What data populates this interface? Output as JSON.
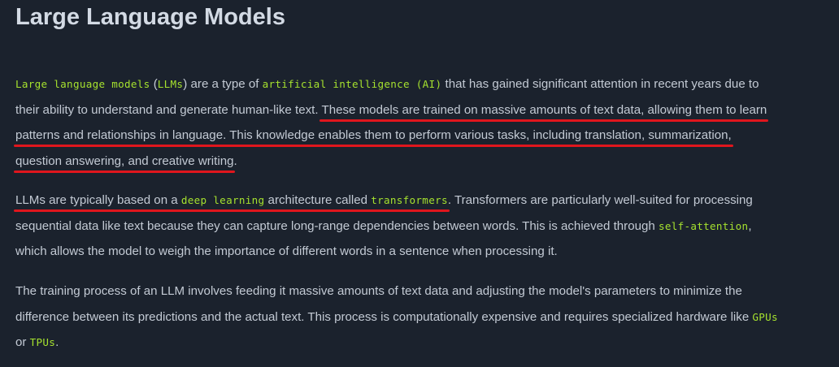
{
  "title": "Large Language Models",
  "colors": {
    "background": "#1b222d",
    "text": "#c3cad4",
    "heading": "#d3dae4",
    "code_term": "#a6e22e",
    "annotation_underline": "#e0161d"
  },
  "p1": {
    "l1_code1": "Large language models",
    "l1_t1": " (",
    "l1_code2": "LLMs",
    "l1_t2": ") are a type of ",
    "l1_code3": "artificial intelligence (AI)",
    "l1_t3": " that has gained significant attention in recent years due to",
    "l2_t1": "their ability to understand and generate human-like text. ",
    "l2_hl": "These models are trained on massive amounts of text data, allowing them to learn",
    "l3_hl": "patterns and relationships in language. This knowledge enables them to perform various tasks, including translation, summarization,",
    "l4_hl": "question answering, and creative writing",
    "l4_t1": "."
  },
  "p2": {
    "l1_hl_t1": "LLMs are typically based on a ",
    "l1_hl_code1": "deep learning",
    "l1_hl_t2": " architecture called ",
    "l1_hl_code2": "transformers",
    "l1_t1": ". Transformers are particularly well-suited for processing",
    "l2_t1": "sequential data like text because they can capture long-range dependencies between words. This is achieved through ",
    "l2_code1": "self-attention",
    "l2_t2": ",",
    "l3_t1": "which allows the model to weigh the importance of different words in a sentence when processing it."
  },
  "p3": {
    "l1_t1": "The training process of an LLM involves feeding it massive amounts of text data and adjusting the model's parameters to minimize the",
    "l2_t1": "difference between its predictions and the actual text. This process is computationally expensive and requires specialized hardware like ",
    "l2_code1": "GPUs",
    "l3_t1": "or ",
    "l3_code1": "TPUs",
    "l3_t2": "."
  }
}
